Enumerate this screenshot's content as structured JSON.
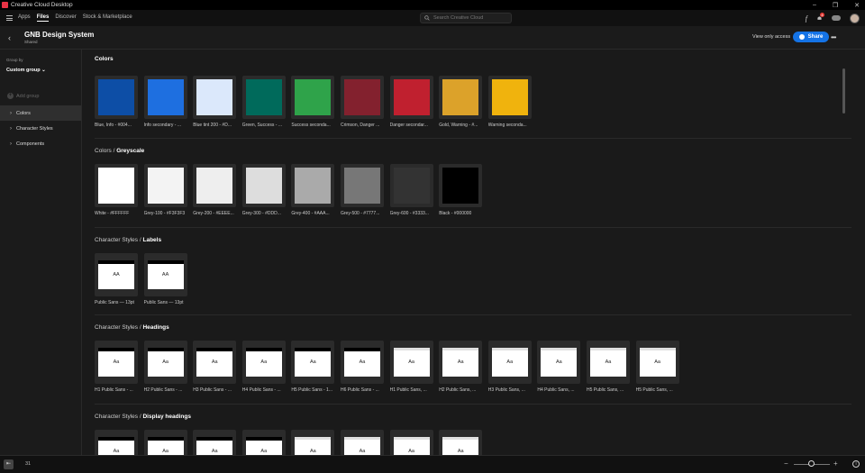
{
  "window": {
    "title": "Creative Cloud Desktop",
    "controls": [
      "–",
      "❐",
      "✕"
    ]
  },
  "nav": {
    "links": [
      "Apps",
      "Files",
      "Discover",
      "Stock & Marketplace"
    ],
    "active": "Files",
    "search_placeholder": "Search Creative Cloud",
    "fonts_glyph": "f",
    "notification_count": "4"
  },
  "header": {
    "back_glyph": "‹",
    "title": "GNB Design System",
    "subtitle": "Shared",
    "view_only": "View only access",
    "share_label": "Share",
    "more_glyph": "•••"
  },
  "sidebar": {
    "group_by_label": "Group by",
    "group_by_value": "Custom group",
    "add_group": "Add group",
    "items": [
      "Colors",
      "Character Styles",
      "Components"
    ],
    "selected_index": 0
  },
  "sections": {
    "colors": {
      "title": "Colors",
      "swatches": [
        {
          "color": "#0d4ea6",
          "label": "Blue, Info - #004..."
        },
        {
          "color": "#1e6fe0",
          "label": "Info secondary - ..."
        },
        {
          "color": "#dbe8fb",
          "label": "Blue tint 200 - #D..."
        },
        {
          "color": "#006a5b",
          "label": "Green, Success - ..."
        },
        {
          "color": "#2fa34a",
          "label": "Success seconda..."
        },
        {
          "color": "#83212e",
          "label": "Crimson, Danger ..."
        },
        {
          "color": "#c0202f",
          "label": "Danger secondar..."
        },
        {
          "color": "#dca22a",
          "label": "Gold, Warning - #..."
        },
        {
          "color": "#f0b30d",
          "label": "Warning seconda..."
        }
      ]
    },
    "greyscale": {
      "prefix": "Colors /",
      "name": "Greyscale",
      "swatches": [
        {
          "color": "#ffffff",
          "label": "White - #FFFFFF"
        },
        {
          "color": "#f3f3f3",
          "label": "Grey-100 - #F3F3F3"
        },
        {
          "color": "#eeeeee",
          "label": "Grey-200 - #EEEE..."
        },
        {
          "color": "#dddddd",
          "label": "Grey-300 - #DDD..."
        },
        {
          "color": "#aaaaaa",
          "label": "Grey-400 - #AAA..."
        },
        {
          "color": "#777777",
          "label": "Grey-500 - #7777..."
        },
        {
          "color": "#333333",
          "label": "Grey-600 - #3333..."
        },
        {
          "color": "#000000",
          "label": "Black - #000000"
        }
      ]
    },
    "labels": {
      "prefix": "Character Styles /",
      "name": "Labels",
      "cards": [
        {
          "glyph": "AA",
          "label": "Public Sans — 13pt"
        },
        {
          "glyph": "AA",
          "label": "Public Sans — 13pt"
        }
      ]
    },
    "headings": {
      "prefix": "Character Styles /",
      "name": "Headings",
      "cards": [
        {
          "glyph": "Aa",
          "label": "H1 Public Sans - ...",
          "dark": true
        },
        {
          "glyph": "Aa",
          "label": "H2 Public Sans - ...",
          "dark": true
        },
        {
          "glyph": "Aa",
          "label": "H3 Public Sans - ...",
          "dark": true
        },
        {
          "glyph": "Aa",
          "label": "H4 Public Sans - ...",
          "dark": true
        },
        {
          "glyph": "Aa",
          "label": "H5 Public Sans - 1...",
          "dark": true
        },
        {
          "glyph": "Aa",
          "label": "H6 Public Sans - ...",
          "dark": true
        },
        {
          "glyph": "Aa",
          "label": "H1 Public Sans, ...",
          "dark": false
        },
        {
          "glyph": "Aa",
          "label": "H2 Public Sans, ...",
          "dark": false
        },
        {
          "glyph": "Aa",
          "label": "H3 Public Sans, ...",
          "dark": false
        },
        {
          "glyph": "Aa",
          "label": "H4 Public Sans, ...",
          "dark": false
        },
        {
          "glyph": "Aa",
          "label": "H5 Public Sans, ...",
          "dark": false
        },
        {
          "glyph": "Aa",
          "label": "H5 Public Sans, ...",
          "dark": false
        }
      ]
    },
    "display": {
      "prefix": "Character Styles /",
      "name": "Display headings",
      "cards": [
        {
          "glyph": "Aa",
          "dark": true
        },
        {
          "glyph": "Aa",
          "dark": true
        },
        {
          "glyph": "Aa",
          "dark": true
        },
        {
          "glyph": "Aa",
          "dark": true
        },
        {
          "glyph": "Aa",
          "dark": false
        },
        {
          "glyph": "Aa",
          "dark": false
        },
        {
          "glyph": "Aa",
          "dark": false
        },
        {
          "glyph": "Aa",
          "dark": false
        }
      ]
    }
  },
  "footer": {
    "count": "31",
    "zoom_minus": "−",
    "zoom_plus": "+",
    "info": "i"
  }
}
